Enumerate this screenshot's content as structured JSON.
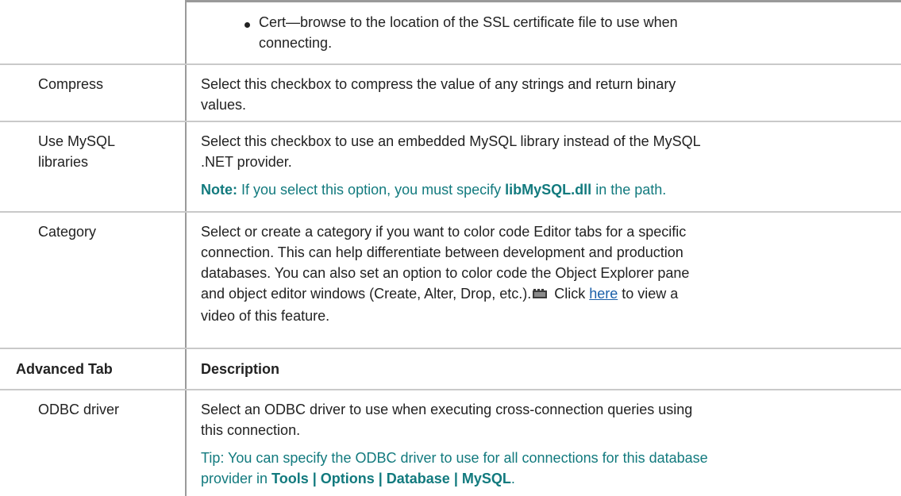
{
  "rows": {
    "cert": {
      "bullet_text_line1": "Cert—browse to the location of the SSL certificate file to use when",
      "bullet_text_line2": "connecting."
    },
    "compress": {
      "term": "Compress",
      "desc_line1": "Select this checkbox to compress the value of any strings and return binary",
      "desc_line2": "values."
    },
    "mysql_libs": {
      "term_line1": "Use MySQL",
      "term_line2": "libraries",
      "desc_line1": "Select this checkbox to use an embedded MySQL library instead of the MySQL",
      "desc_line2": ".NET provider.",
      "note_label": "Note:",
      "note_text_before": " If you select this option, you must specify ",
      "note_bold": "libMySQL.dll",
      "note_text_after": " in the path."
    },
    "category": {
      "term": "Category",
      "desc_line1": "Select or create a category if you want to color code Editor tabs for a specific",
      "desc_line2": "connection. This can help differentiate between development and production",
      "desc_line3": "databases. You can also set an option to color code the Object Explorer pane",
      "desc_line4_before": "and object editor windows (Create, Alter, Drop, etc.).",
      "desc_line4_click": " Click ",
      "link_text": "here",
      "desc_line4_after": " to view a",
      "desc_line5": "video of this feature.",
      "video_icon": "video-icon"
    },
    "advanced_header": {
      "col1": "Advanced Tab",
      "col2": "Description"
    },
    "odbc": {
      "term": "ODBC driver",
      "desc_line1": "Select an ODBC driver to use when executing cross-connection queries using",
      "desc_line2": "this connection.",
      "tip_line1": "Tip: You can specify the ODBC driver to use for all connections for this database",
      "tip_line2_before": "provider in ",
      "tip_bold": "Tools | Options | Database | MySQL",
      "tip_line2_after": "."
    }
  },
  "colors": {
    "note_teal": "#127a7e",
    "link_blue": "#1a5fa8",
    "border": "#9a9a9a"
  }
}
